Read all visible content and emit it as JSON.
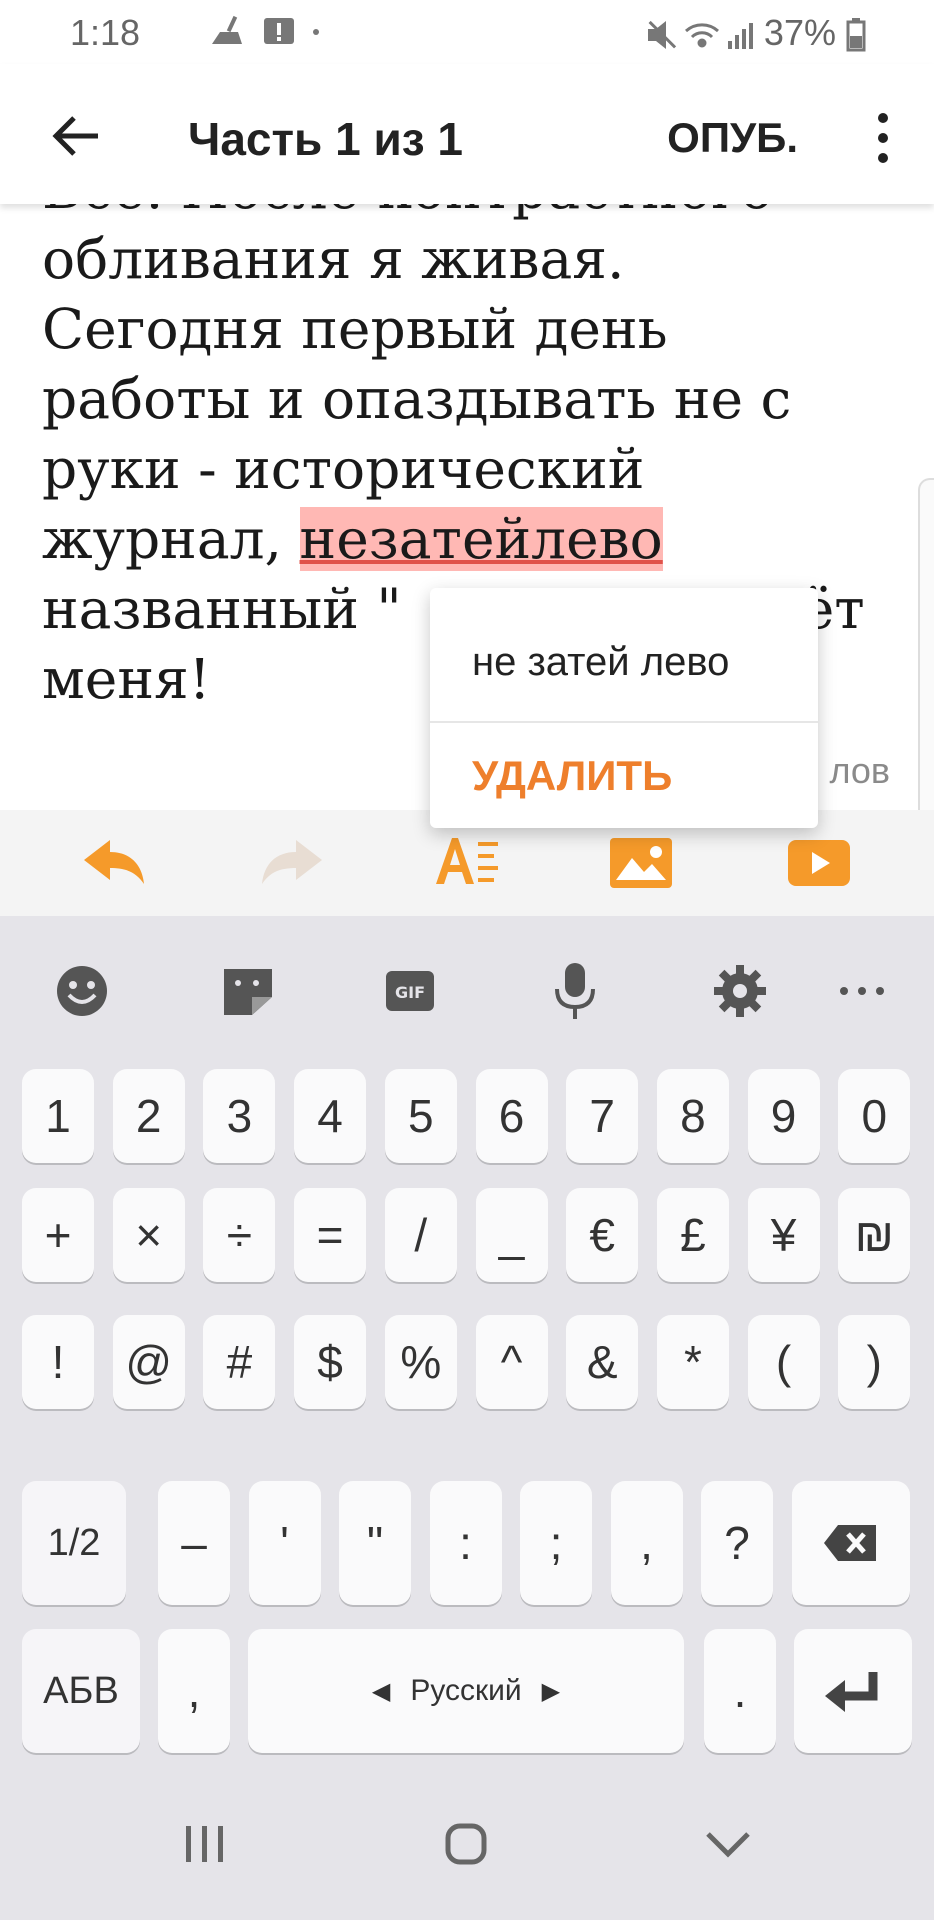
{
  "status_bar": {
    "time": "1:18",
    "battery": "37%"
  },
  "app_bar": {
    "title": "Часть 1 из 1",
    "publish_label": "ОПУБ."
  },
  "editor": {
    "line1": "Все. После контрастного",
    "line2": "обливания я живая.",
    "line3": "Сегодня первый день",
    "line4": "работы и опаздывать не с",
    "line5": "руки - исторический",
    "line6_before": "журнал, ",
    "highlighted_word": "незатейлево",
    "line7_before": "названный \"",
    "line7_after": "ёт",
    "line8": "меня!",
    "word_counter": "лов"
  },
  "spell_popup": {
    "suggestion": "не затей лево",
    "delete_label": "УДАЛИТЬ"
  },
  "colors": {
    "accent": "#f59a2a",
    "delete_text": "#ee7f2c",
    "highlight": "#ffb8b4"
  },
  "keyboard": {
    "row1": [
      "1",
      "2",
      "3",
      "4",
      "5",
      "6",
      "7",
      "8",
      "9",
      "0"
    ],
    "row2": [
      "+",
      "×",
      "÷",
      "=",
      "/",
      "_",
      "€",
      "£",
      "¥",
      "₪"
    ],
    "row3": [
      "!",
      "@",
      "#",
      "$",
      "%",
      "^",
      "&",
      "*",
      "(",
      ")"
    ],
    "row4": {
      "page": "1/2",
      "keys": [
        "–",
        "'",
        "\"",
        ":",
        ";",
        ",",
        "?"
      ]
    },
    "row5": {
      "abc": "АБВ",
      "comma": ",",
      "space": "Русский",
      "period": "."
    }
  }
}
